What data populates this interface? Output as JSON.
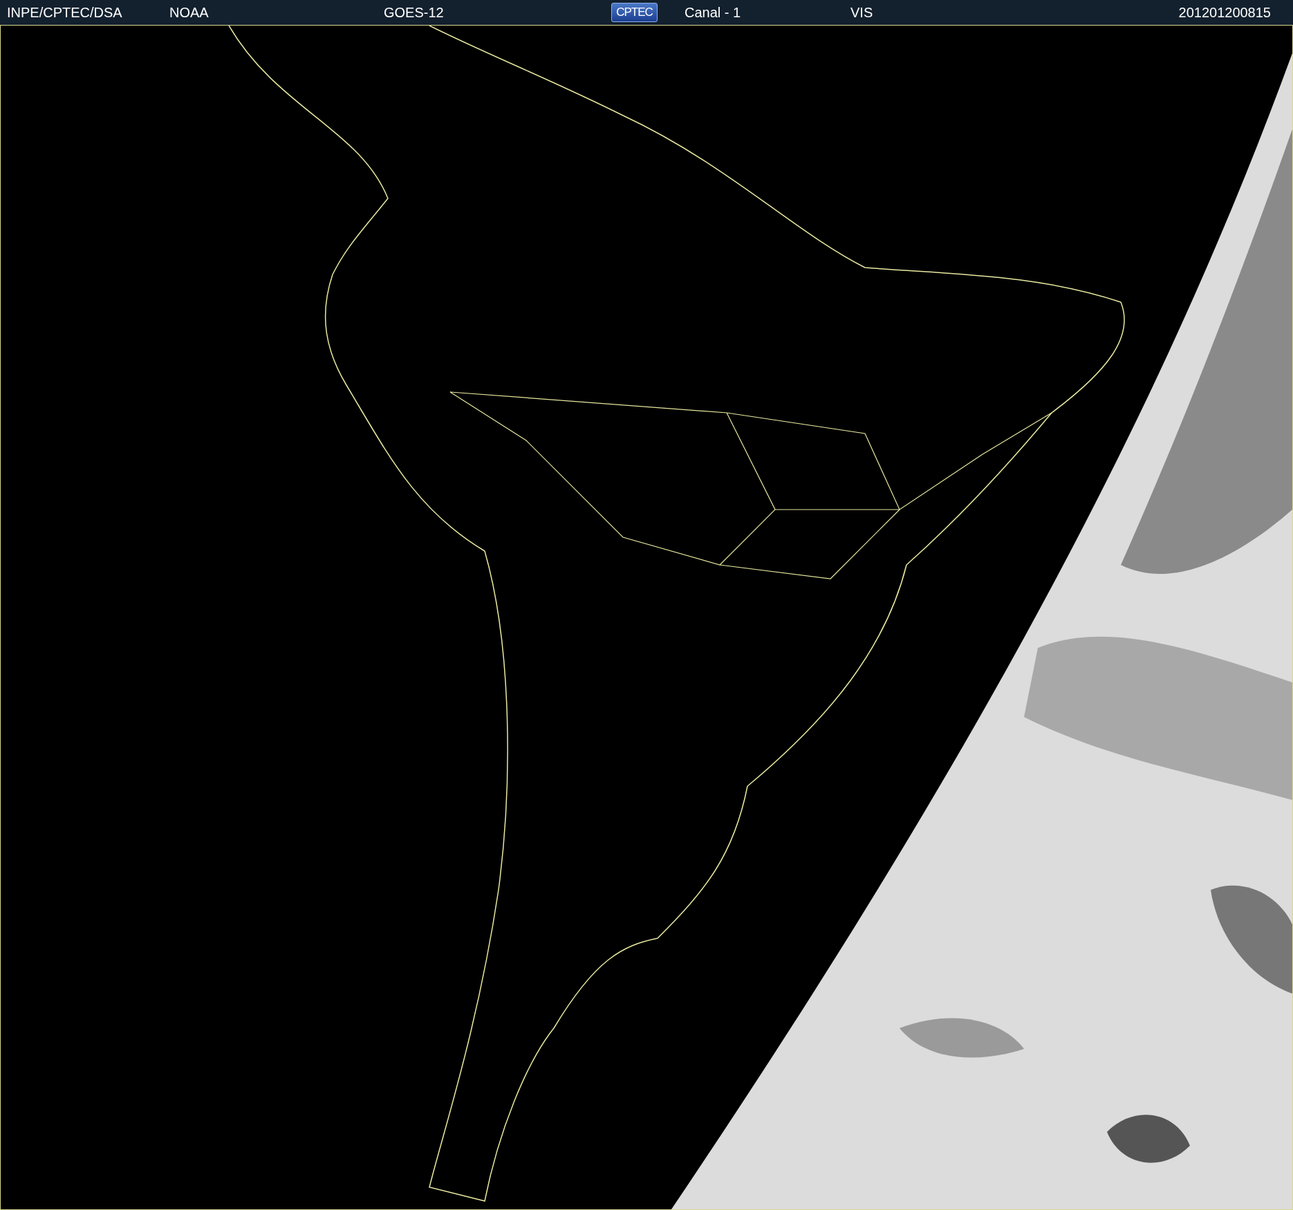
{
  "header": {
    "items": [
      {
        "kind": "text",
        "label": "INPE/CPTEC/DSA"
      },
      {
        "kind": "text",
        "label": "NOAA"
      },
      {
        "kind": "text",
        "label": "GOES-12"
      },
      {
        "kind": "logo",
        "label": "CPTEC"
      },
      {
        "kind": "text",
        "label": "Canal - 1"
      },
      {
        "kind": "text",
        "label": "VIS"
      },
      {
        "kind": "text",
        "label": "201201200815"
      }
    ]
  }
}
